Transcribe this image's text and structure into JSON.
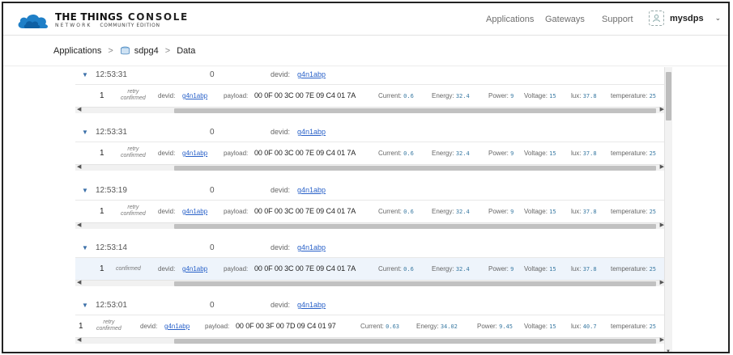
{
  "header": {
    "brand_line1": "THE THINGS",
    "brand_console": "CONSOLE",
    "brand_line2": "NETWORK",
    "brand_edition": "COMMUNITY EDITION",
    "nav": {
      "applications": "Applications",
      "gateways": "Gateways",
      "support": "Support"
    },
    "user": {
      "name": "mysdps",
      "caret": "⌄"
    }
  },
  "breadcrumb": {
    "root": "Applications",
    "separator": ">",
    "app": "sdpg4",
    "page": "Data"
  },
  "colors": {
    "accent": "#2a62c9",
    "metric_value": "#3a7aa3",
    "cloud_logo": "#1f7fc7",
    "highlight_row": "#eef4fb"
  },
  "labels": {
    "devid": "devid:",
    "payload": "payload:",
    "current": "Current:",
    "energy": "Energy:",
    "power": "Power:",
    "voltage": "Voltage:",
    "lux": "lux:",
    "temperature": "temperature:",
    "retry": "retry",
    "confirmed": "confirmed"
  },
  "events": [
    {
      "time": "12:53:31",
      "count": "0",
      "dev_id": "g4n1abp",
      "counter": "1",
      "retry": true,
      "payload": "00 0F 00 3C 00 7E 09 C4 01 7A",
      "current": "0.6",
      "energy": "32.4",
      "power": "9",
      "voltage": "15",
      "lux": "37.8",
      "temperature": "25",
      "highlighted": false
    },
    {
      "time": "12:53:31",
      "count": "0",
      "dev_id": "g4n1abp",
      "counter": "1",
      "retry": true,
      "payload": "00 0F 00 3C 00 7E 09 C4 01 7A",
      "current": "0.6",
      "energy": "32.4",
      "power": "9",
      "voltage": "15",
      "lux": "37.8",
      "temperature": "25",
      "highlighted": false
    },
    {
      "time": "12:53:19",
      "count": "0",
      "dev_id": "g4n1abp",
      "counter": "1",
      "retry": true,
      "payload": "00 0F 00 3C 00 7E 09 C4 01 7A",
      "current": "0.6",
      "energy": "32.4",
      "power": "9",
      "voltage": "15",
      "lux": "37.8",
      "temperature": "25",
      "highlighted": false
    },
    {
      "time": "12:53:14",
      "count": "0",
      "dev_id": "g4n1abp",
      "counter": "1",
      "retry": false,
      "payload": "00 0F 00 3C 00 7E 09 C4 01 7A",
      "current": "0.6",
      "energy": "32.4",
      "power": "9",
      "voltage": "15",
      "lux": "37.8",
      "temperature": "25",
      "highlighted": true
    },
    {
      "time": "12:53:01",
      "count": "0",
      "dev_id": "g4n1abp",
      "counter": "1",
      "retry": true,
      "payload": "00 0F 00 3F 00 7D 09 C4 01 97",
      "current": "0.63",
      "energy": "34.02",
      "power": "9.45",
      "voltage": "15",
      "lux": "40.7",
      "temperature": "25",
      "highlighted": false
    }
  ]
}
